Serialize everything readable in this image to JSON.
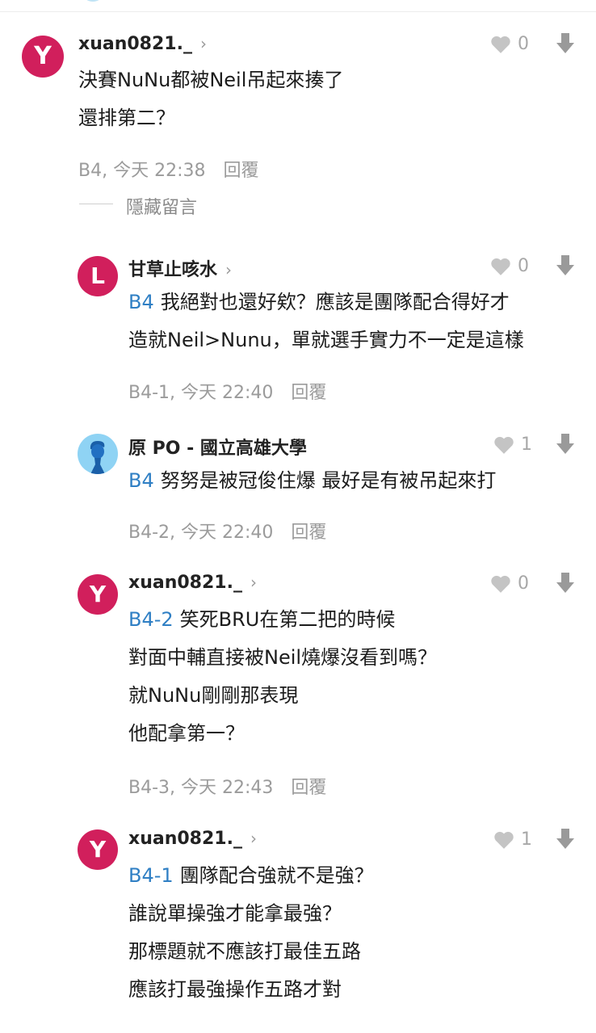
{
  "colors": {
    "avatar_pink": "#d11f5c",
    "op_avatar_blue": "#8fd3f4",
    "reference_blue": "#2f7fc4",
    "meta_gray": "#9b9b9b"
  },
  "comments": [
    {
      "author": "xuan0821._",
      "avatar_letter": "Y",
      "likes": "0",
      "lines": [
        "決賽NuNu都被Neil吊起來揍了",
        "還排第二？"
      ],
      "floor": "B4, 今天 22:38",
      "reply_label": "回覆",
      "hide_label": "隱藏留言"
    }
  ],
  "replies": [
    {
      "author": "甘草止咳水",
      "avatar_letter": "L",
      "likes": "0",
      "ref": "B4",
      "lines": [
        "我絕對也還好欸？應該是團隊配合得好才",
        "造就Neil>Nunu，單就選手實力不一定是這樣"
      ],
      "floor": "B4-1, 今天 22:40",
      "reply_label": "回覆"
    },
    {
      "author": "原 PO - 國立高雄大學",
      "avatar_icon": "person-silhouette-icon",
      "likes": "1",
      "ref": "B4",
      "lines": [
        "努努是被冠俊住爆 最好是有被吊起來打"
      ],
      "floor": "B4-2, 今天 22:40",
      "reply_label": "回覆"
    },
    {
      "author": "xuan0821._",
      "avatar_letter": "Y",
      "likes": "0",
      "ref": "B4-2",
      "lines": [
        "笑死BRU在第二把的時候",
        "對面中輔直接被Neil燒爆沒看到嗎？",
        "就NuNu剛剛那表現",
        "他配拿第一？"
      ],
      "floor": "B4-3, 今天 22:43",
      "reply_label": "回覆"
    },
    {
      "author": "xuan0821._",
      "avatar_letter": "Y",
      "likes": "1",
      "ref": "B4-1",
      "lines": [
        "團隊配合強就不是強？",
        "誰說單操強才能拿最強？",
        "那標題就不應該打最佳五路",
        "應該打最強操作五路才對"
      ]
    }
  ]
}
